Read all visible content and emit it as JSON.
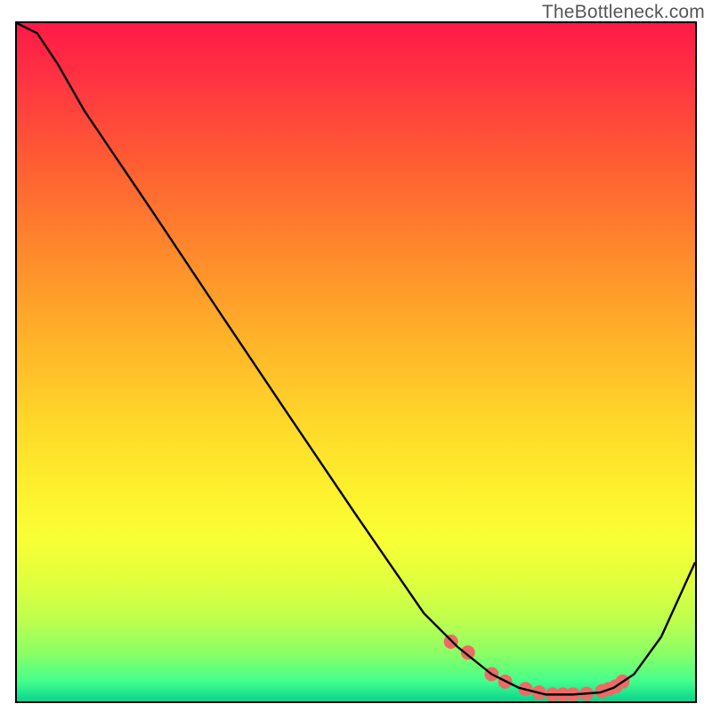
{
  "watermark": "TheBottleneck.com",
  "chart_data": {
    "type": "line",
    "title": "",
    "xlabel": "",
    "ylabel": "",
    "xlim": [
      0,
      100
    ],
    "ylim": [
      0,
      100
    ],
    "grid": false,
    "legend": false,
    "background": "heatmap-gradient-vertical",
    "series": [
      {
        "name": "curve",
        "color": "#000000",
        "x": [
          0,
          3,
          5,
          6,
          10,
          20,
          30,
          40,
          50,
          60,
          65,
          70,
          74,
          78,
          82,
          86,
          88,
          91,
          95,
          100
        ],
        "y": [
          100,
          98.5,
          95.5,
          94,
          87,
          72.2,
          57.2,
          42.3,
          27.5,
          13,
          8,
          4,
          2,
          1,
          1,
          1.3,
          2,
          4,
          9.5,
          20.5
        ]
      }
    ],
    "markers": {
      "name": "highlight-dots",
      "color": "#ec6b66",
      "radius_px": 8,
      "x": [
        64,
        66.5,
        70,
        72,
        75,
        77,
        79,
        80.5,
        82,
        84,
        86.3,
        87.3,
        88.3,
        89.3
      ],
      "y": [
        8.8,
        7.2,
        4.0,
        2.9,
        1.8,
        1.3,
        1.0,
        1.0,
        1.0,
        1.1,
        1.5,
        1.8,
        2.2,
        2.9
      ]
    }
  }
}
